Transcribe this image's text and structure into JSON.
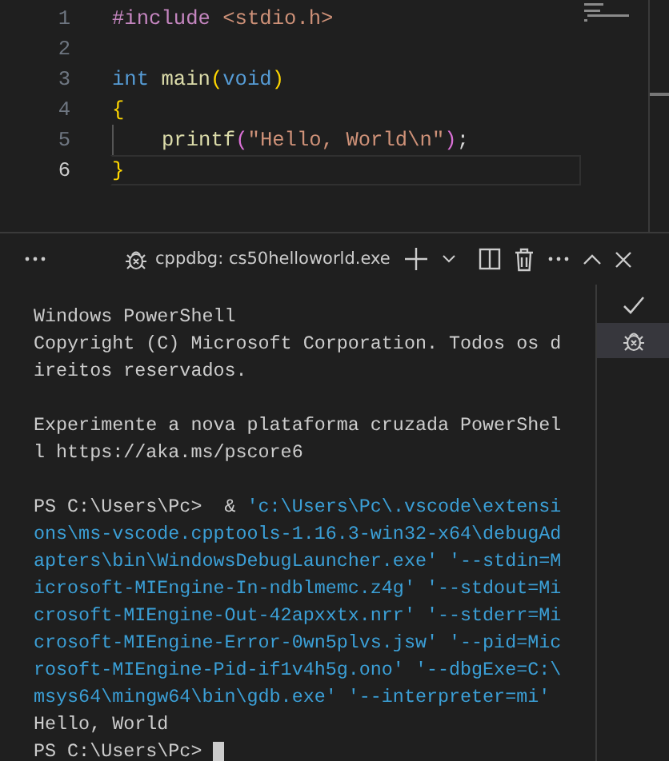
{
  "editor": {
    "lines": [
      {
        "number": "1",
        "current": false,
        "indented": false,
        "tokens": [
          {
            "text": "#include ",
            "kind": "directive"
          },
          {
            "text": "<stdio.h>",
            "kind": "string"
          }
        ]
      },
      {
        "number": "2",
        "current": false,
        "indented": false
      },
      {
        "number": "3",
        "current": false,
        "indented": false,
        "tokens": [
          {
            "text": "int ",
            "kind": "keyword"
          },
          {
            "text": "main",
            "kind": "function"
          },
          {
            "text": "(",
            "kind": "bracket1"
          },
          {
            "text": "void",
            "kind": "keyword"
          },
          {
            "text": ")",
            "kind": "bracket1"
          }
        ]
      },
      {
        "number": "4",
        "current": false,
        "indented": false,
        "tokens": [
          {
            "text": "{",
            "kind": "bracket1"
          }
        ]
      },
      {
        "number": "5",
        "current": false,
        "indented": true,
        "tokens": [
          {
            "text": "printf",
            "kind": "function"
          },
          {
            "text": "(",
            "kind": "bracket2"
          },
          {
            "text": "\"Hello, World\\n\"",
            "kind": "string"
          },
          {
            "text": ")",
            "kind": "bracket2"
          },
          {
            "text": ";",
            "kind": "plain"
          }
        ]
      },
      {
        "number": "6",
        "current": true,
        "indented": false,
        "tokens": [
          {
            "text": "}",
            "kind": "bracket1"
          }
        ]
      }
    ]
  },
  "terminal": {
    "title": "cppdbg: cs50helloworld.exe",
    "blocks": [
      [
        [
          {
            "text": "Windows PowerShell",
            "kind": "output"
          }
        ],
        [
          {
            "text": "Copyright (C) Microsoft Corporation. Todos os d",
            "kind": "output"
          }
        ],
        [
          {
            "text": "ireitos reservados.",
            "kind": "output"
          }
        ]
      ],
      [
        [
          {
            "text": "Experimente a nova plataforma cruzada PowerShel",
            "kind": "output"
          }
        ],
        [
          {
            "text": "l https://aka.ms/pscore6",
            "kind": "output"
          }
        ]
      ],
      [
        [
          {
            "text": "PS C:\\Users\\Pc>  & ",
            "kind": "output"
          },
          {
            "text": "'c:\\Users\\Pc\\.vscode\\extensi",
            "kind": "string"
          }
        ],
        [
          {
            "text": "ons\\ms-vscode.cpptools-1.16.3-win32-x64\\debugAd",
            "kind": "string"
          }
        ],
        [
          {
            "text": "apters\\bin\\WindowsDebugLauncher.exe' '--stdin=M",
            "kind": "string"
          }
        ],
        [
          {
            "text": "icrosoft-MIEngine-In-ndblmemc.z4g' '--stdout=Mi",
            "kind": "string"
          }
        ],
        [
          {
            "text": "crosoft-MIEngine-Out-42apxxtx.nrr' '--stderr=Mi",
            "kind": "string"
          }
        ],
        [
          {
            "text": "crosoft-MIEngine-Error-0wn5plvs.jsw' '--pid=Mic",
            "kind": "string"
          }
        ],
        [
          {
            "text": "rosoft-MIEngine-Pid-if1v4h5g.ono' '--dbgExe=C:\\",
            "kind": "string"
          }
        ],
        [
          {
            "text": "msys64\\mingw64\\bin\\gdb.exe' '--interpreter=mi'",
            "kind": "string"
          }
        ],
        [
          {
            "text": "Hello, World",
            "kind": "output"
          }
        ],
        [
          {
            "text": "PS C:\\Users\\Pc> ",
            "kind": "output"
          },
          {
            "kind": "cursor"
          }
        ]
      ]
    ],
    "sessions": [
      {
        "kind": "task",
        "selected": false
      },
      {
        "kind": "debug",
        "selected": true
      }
    ]
  }
}
